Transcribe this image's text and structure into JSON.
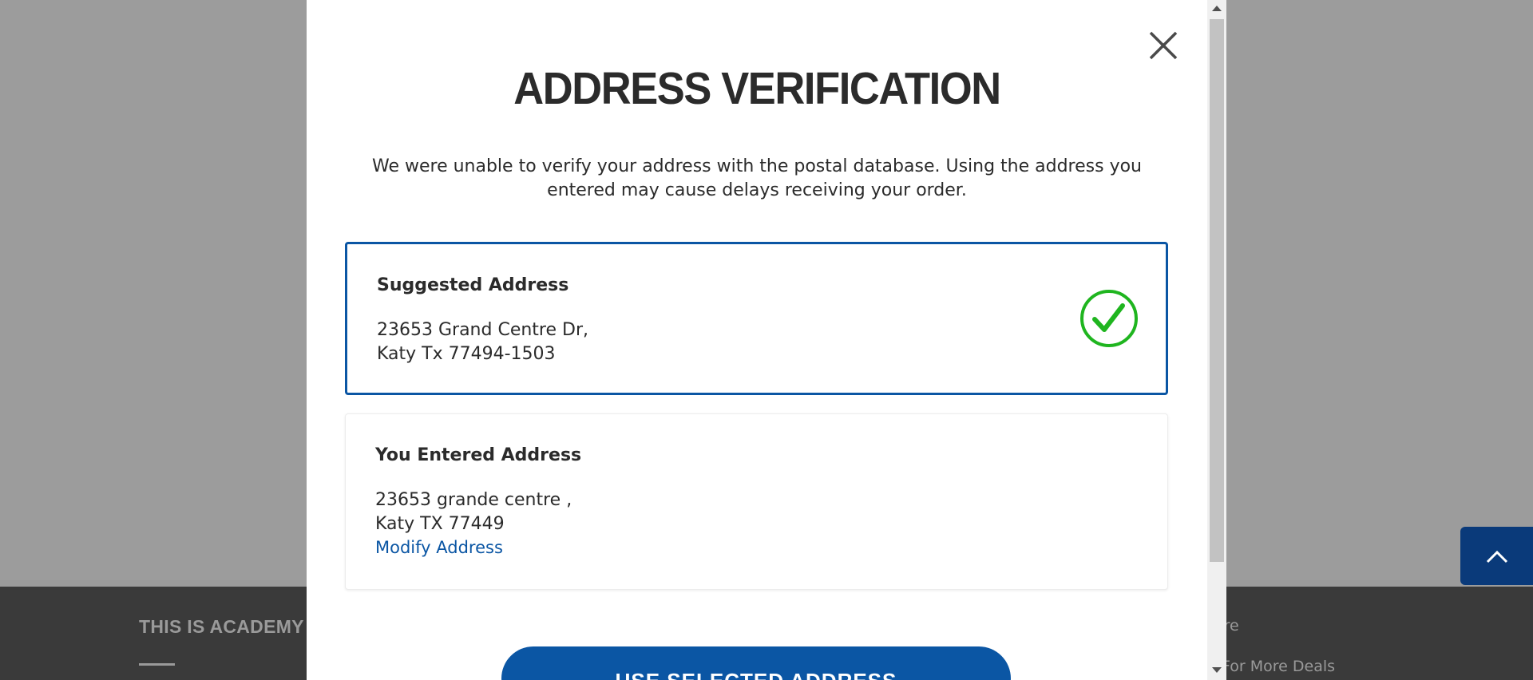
{
  "background": {
    "footer_heading": "THIS IS ACADEMY",
    "footer_link_1": "ore",
    "footer_link_2": "For More Deals",
    "back_to_top_icon": "chevron-up-icon"
  },
  "modal": {
    "title": "ADDRESS VERIFICATION",
    "description": "We were unable to verify your address with the postal database. Using the address you entered may cause delays receiving your order.",
    "close_icon": "close-icon",
    "suggested": {
      "title": "Suggested Address",
      "line1": "23653 Grand Centre Dr,",
      "line2": "Katy Tx 77494-1503",
      "selected": true,
      "icon": "check-circle-icon"
    },
    "entered": {
      "title": "You Entered Address",
      "line1": "23653 grande centre ,",
      "line2": "Katy TX 77449",
      "modify_label": "Modify Address",
      "selected": false
    },
    "primary_button_label": "USE SELECTED ADDRESS"
  },
  "colors": {
    "brand_blue": "#0b56a4",
    "check_green": "#1fb51f",
    "overlay_gray": "#9c9c9c",
    "text_dark": "#2b2b2b"
  }
}
